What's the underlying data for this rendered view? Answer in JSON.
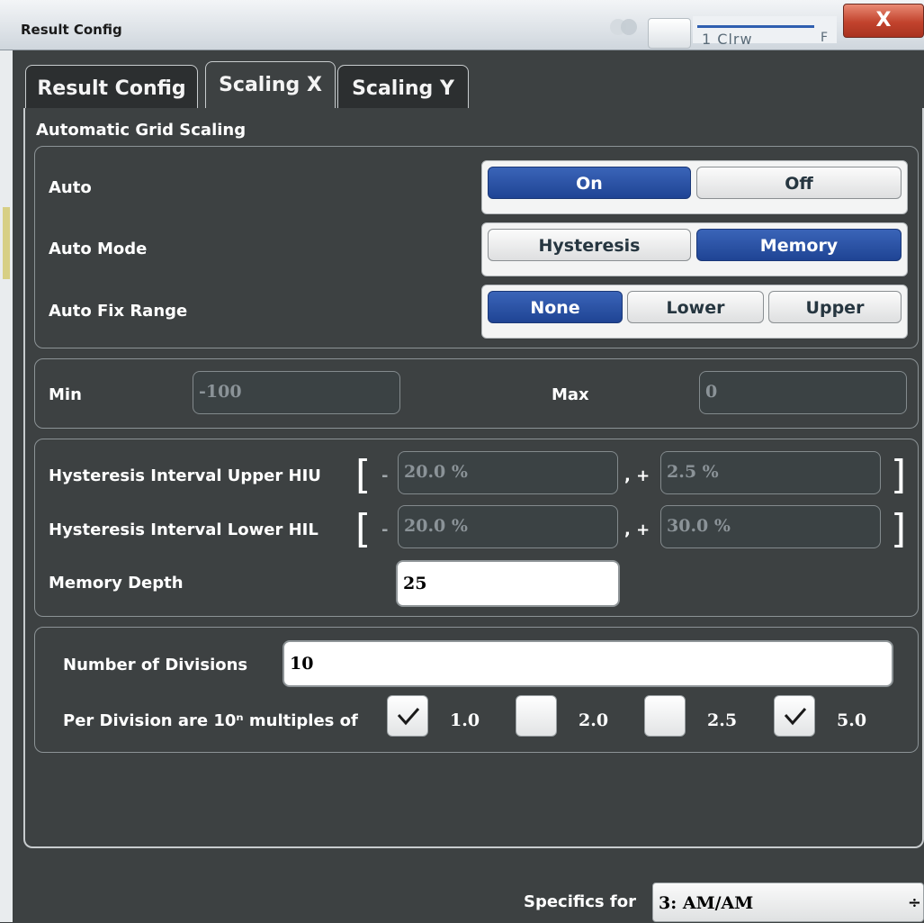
{
  "window": {
    "title": "Result Config",
    "close_label": "X",
    "trace_label": "1 Clrw",
    "extra_label": "F"
  },
  "tabs": [
    {
      "label": "Result Config",
      "active": false
    },
    {
      "label": "Scaling X",
      "active": true
    },
    {
      "label": "Scaling Y",
      "active": false
    }
  ],
  "section_title": "Automatic Grid Scaling",
  "auto": {
    "label": "Auto",
    "options": [
      "On",
      "Off"
    ],
    "selected": "On"
  },
  "auto_mode": {
    "label": "Auto Mode",
    "options": [
      "Hysteresis",
      "Memory"
    ],
    "selected": "Memory"
  },
  "auto_fix_range": {
    "label": "Auto Fix Range",
    "options": [
      "None",
      "Lower",
      "Upper"
    ],
    "selected": "None"
  },
  "min": {
    "label": "Min",
    "value": "-100"
  },
  "max": {
    "label": "Max",
    "value": "0"
  },
  "hiu": {
    "label": "Hysteresis Interval Upper HIU",
    "minus_sign": "-",
    "minus_value": "20.0 %",
    "plus_sign": ", +",
    "plus_value": "2.5 %",
    "open": "[",
    "close": "]"
  },
  "hil": {
    "label": "Hysteresis Interval Lower HIL",
    "minus_sign": "-",
    "minus_value": "20.0 %",
    "plus_sign": ", +",
    "plus_value": "30.0 %",
    "open": "[",
    "close": "]"
  },
  "memory_depth": {
    "label": "Memory Depth",
    "value": "25"
  },
  "divisions": {
    "label": "Number of Divisions",
    "value": "10"
  },
  "per_division": {
    "label": "Per Division are 10ⁿ multiples of",
    "options": [
      {
        "value": "1.0",
        "checked": true
      },
      {
        "value": "2.0",
        "checked": false
      },
      {
        "value": "2.5",
        "checked": false
      },
      {
        "value": "5.0",
        "checked": true
      }
    ]
  },
  "specifics": {
    "label": "Specifics for",
    "value": "3: AM/AM",
    "arrow": "÷"
  },
  "colors": {
    "accent": "#1f4494",
    "background": "#3d4142",
    "close": "#c2432d"
  }
}
